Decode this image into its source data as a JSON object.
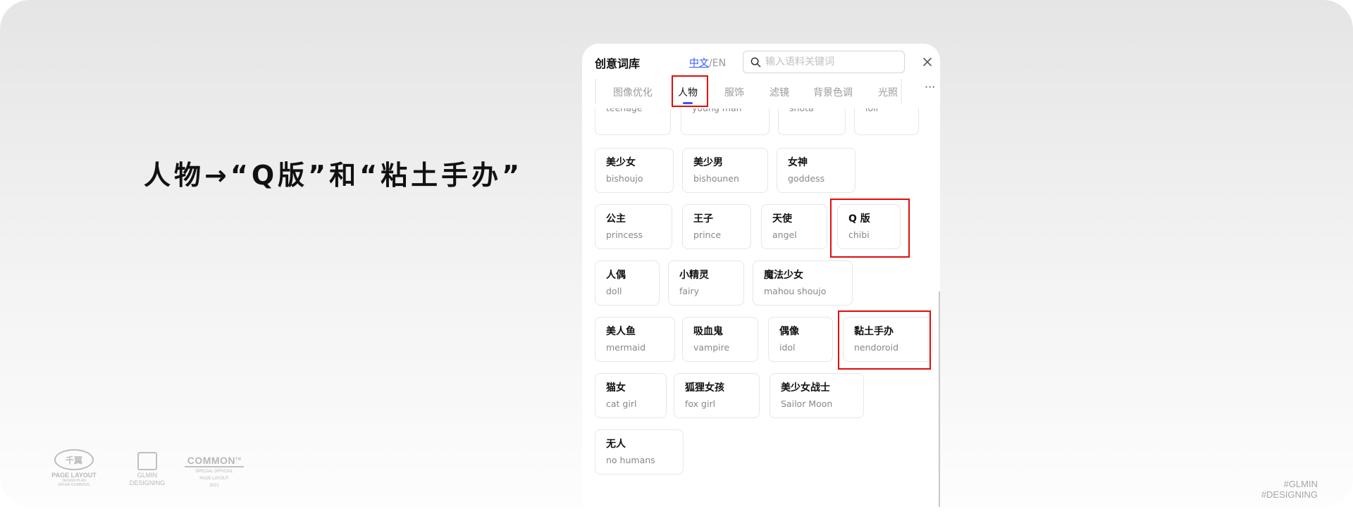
{
  "headline": "人物→“Q版”和“粘土手办”",
  "footer": {
    "logo1": {
      "mark": "千翼",
      "line1": "PAGE LAYOUT",
      "line2": "DESIGN PLAN",
      "line3": "OFFER GLMIN2021"
    },
    "logo2": {
      "line1": "GLMIN",
      "line2": "DESIGNING"
    },
    "logo3": {
      "big": "COMMON",
      "tm": "TM",
      "line1": "SPECIAL OFFICIAL",
      "line2": "PAGE LAYOUT",
      "line3": "2021"
    },
    "tag1": "#GLMIN",
    "tag2": "#DESIGNING"
  },
  "panel": {
    "title": "创意词库",
    "lang_cn": "中文",
    "lang_sep": "/",
    "lang_en": "EN",
    "search_placeholder": "输入语料关键词",
    "tabs": [
      "图像优化",
      "人物",
      "服饰",
      "滤镜",
      "背景色调",
      "光照"
    ],
    "active_tab": "人物",
    "more": "···",
    "cards": [
      {
        "zh": "",
        "en": "teenage"
      },
      {
        "zh": "",
        "en": "young man"
      },
      {
        "zh": "",
        "en": "shota"
      },
      {
        "zh": "",
        "en": "loli"
      },
      {
        "zh": "美少女",
        "en": "bishoujo"
      },
      {
        "zh": "美少男",
        "en": "bishounen"
      },
      {
        "zh": "女神",
        "en": "goddess"
      },
      {
        "zh": "公主",
        "en": "princess"
      },
      {
        "zh": "王子",
        "en": "prince"
      },
      {
        "zh": "天使",
        "en": "angel"
      },
      {
        "zh": "Q 版",
        "en": "chibi"
      },
      {
        "zh": "人偶",
        "en": "doll"
      },
      {
        "zh": "小精灵",
        "en": "fairy"
      },
      {
        "zh": "魔法少女",
        "en": "mahou shoujo"
      },
      {
        "zh": "美人鱼",
        "en": "mermaid"
      },
      {
        "zh": "吸血鬼",
        "en": "vampire"
      },
      {
        "zh": "偶像",
        "en": "idol"
      },
      {
        "zh": "黏土手办",
        "en": "nendoroid"
      },
      {
        "zh": "猫女",
        "en": "cat girl"
      },
      {
        "zh": "狐狸女孩",
        "en": "fox girl"
      },
      {
        "zh": "美少女战士",
        "en": "Sailor Moon"
      },
      {
        "zh": "无人",
        "en": "no humans"
      }
    ]
  },
  "colors": {
    "accent": "#2f56ff",
    "highlight": "#e30b0b"
  },
  "icons": {
    "search": "search-icon",
    "close": "close-icon",
    "more": "more-icon"
  }
}
